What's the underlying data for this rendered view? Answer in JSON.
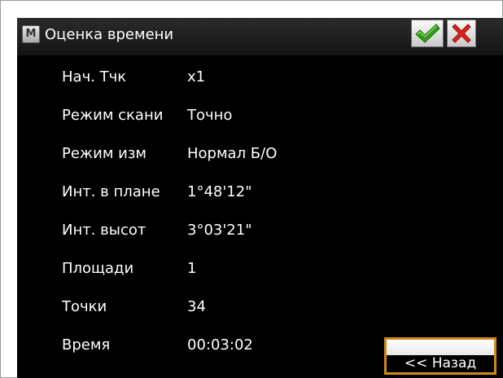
{
  "window": {
    "title": "Оценка времени",
    "menu_glyph": "M"
  },
  "toolbar": {
    "ok_icon": "checkmark-icon",
    "cancel_icon": "close-x-icon",
    "ok_color": "#2e9e1a",
    "cancel_color": "#e0211c"
  },
  "fields": [
    {
      "label": "Нач. Тчк",
      "value": "x1"
    },
    {
      "label": "Режим скани",
      "value": "Точно"
    },
    {
      "label": "Режим изм",
      "value": "Нормал Б/О"
    },
    {
      "label": "Инт. в плане",
      "value": "1°48'12\""
    },
    {
      "label": "Инт. высот",
      "value": "3°03'21\""
    },
    {
      "label": "Площади",
      "value": "1"
    },
    {
      "label": "Точки",
      "value": "34"
    },
    {
      "label": "Время",
      "value": "00:03:02"
    }
  ],
  "back_button": {
    "label": "<< Назад",
    "accent": "#d08a18"
  }
}
